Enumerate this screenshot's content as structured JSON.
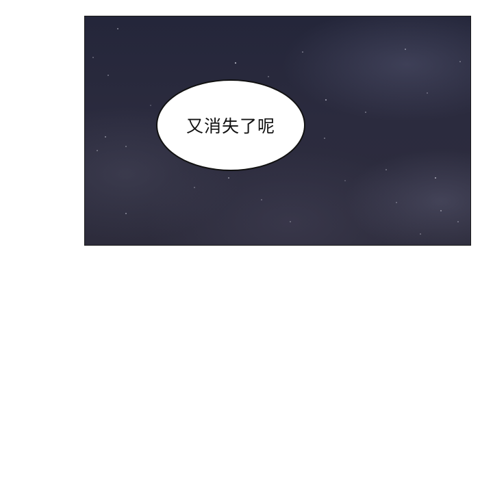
{
  "panel": {
    "background_color": "#2a2b3d",
    "border_color": "#1a1a1a"
  },
  "speech_bubble": {
    "text": "又消失了呢"
  }
}
